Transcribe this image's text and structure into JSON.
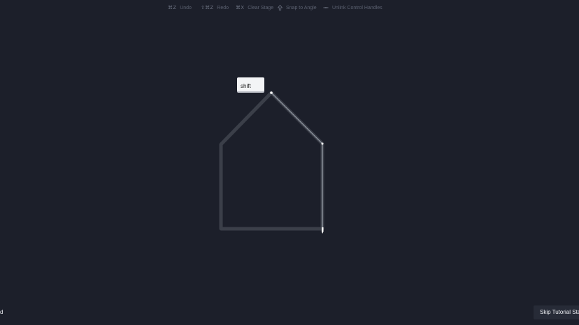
{
  "toolbar": {
    "undo": {
      "key": "⌘Z",
      "label": "Undo",
      "icon": "undo-key-icon"
    },
    "redo": {
      "key": "⇧⌘Z",
      "label": "Redo",
      "icon": "redo-key-icon"
    },
    "clear": {
      "key": "⌘X",
      "label": "Clear Stage",
      "icon": "clear-key-icon"
    },
    "snap": {
      "label": "Snap to Angle",
      "icon": "shift-arrow-icon"
    },
    "unlink": {
      "label": "Unlink Control Handles",
      "icon": "unlink-icon"
    }
  },
  "key_hint": {
    "label": "shift"
  },
  "mode_label": "d",
  "skip_button": {
    "label": "Skip Tutorial Stage"
  },
  "colors": {
    "background": "#1c1f2a",
    "guide_path": "#3b3f49",
    "drawn_path": "#9aa0aa",
    "toolbar_text": "#5b6170"
  }
}
